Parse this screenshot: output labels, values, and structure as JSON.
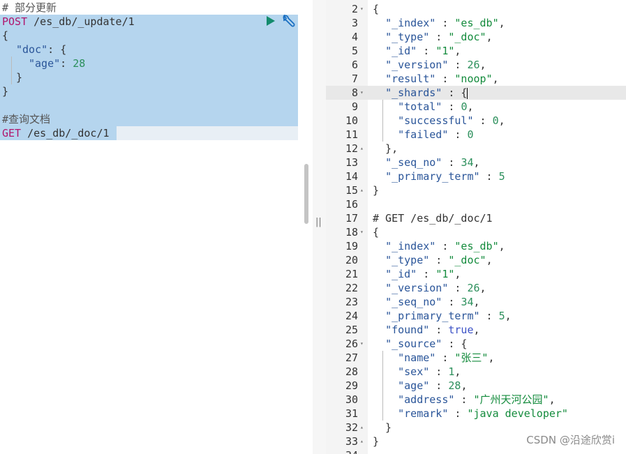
{
  "left_editor": {
    "lines": [
      {
        "text": "# 部分更新",
        "kind": "comment"
      },
      {
        "method": "POST",
        "path": "/es_db/_update/1"
      },
      {
        "text": "{"
      },
      {
        "key": "\"doc\"",
        "rest": ": {"
      },
      {
        "key": "\"age\"",
        "sep": ": ",
        "value": "28"
      },
      {
        "text": "}"
      },
      {
        "text": "}"
      },
      {
        "text": ""
      },
      {
        "text": "#查询文档",
        "kind": "comment"
      },
      {
        "method": "GET",
        "path": "/es_db/_doc/1"
      }
    ],
    "run_icon": "play-icon",
    "settings_icon": "wrench-icon"
  },
  "right_output": {
    "lines": [
      {
        "n": "2",
        "fold": "▾",
        "code": "{"
      },
      {
        "n": "3",
        "code": "  \"_index\" : \"es_db\","
      },
      {
        "n": "4",
        "code": "  \"_type\" : \"_doc\","
      },
      {
        "n": "5",
        "code": "  \"_id\" : \"1\","
      },
      {
        "n": "6",
        "code": "  \"_version\" : 26,"
      },
      {
        "n": "7",
        "code": "  \"result\" : \"noop\","
      },
      {
        "n": "8",
        "fold": "▾",
        "code": "  \"_shards\" : {",
        "active": true
      },
      {
        "n": "9",
        "code": "    \"total\" : 0,"
      },
      {
        "n": "10",
        "code": "    \"successful\" : 0,"
      },
      {
        "n": "11",
        "code": "    \"failed\" : 0"
      },
      {
        "n": "12",
        "fold": "▴",
        "code": "  },"
      },
      {
        "n": "13",
        "code": "  \"_seq_no\" : 34,"
      },
      {
        "n": "14",
        "code": "  \"_primary_term\" : 5"
      },
      {
        "n": "15",
        "fold": "▴",
        "code": "}"
      },
      {
        "n": "16",
        "code": ""
      },
      {
        "n": "17",
        "code": "# GET /es_db/_doc/1"
      },
      {
        "n": "18",
        "fold": "▾",
        "code": "{"
      },
      {
        "n": "19",
        "code": "  \"_index\" : \"es_db\","
      },
      {
        "n": "20",
        "code": "  \"_type\" : \"_doc\","
      },
      {
        "n": "21",
        "code": "  \"_id\" : \"1\","
      },
      {
        "n": "22",
        "code": "  \"_version\" : 26,"
      },
      {
        "n": "23",
        "code": "  \"_seq_no\" : 34,"
      },
      {
        "n": "24",
        "code": "  \"_primary_term\" : 5,"
      },
      {
        "n": "25",
        "code": "  \"found\" : true,"
      },
      {
        "n": "26",
        "fold": "▾",
        "code": "  \"_source\" : {"
      },
      {
        "n": "27",
        "code": "    \"name\" : \"张三\","
      },
      {
        "n": "28",
        "code": "    \"sex\" : 1,"
      },
      {
        "n": "29",
        "code": "    \"age\" : 28,"
      },
      {
        "n": "30",
        "code": "    \"address\" : \"广州天河公园\","
      },
      {
        "n": "31",
        "code": "    \"remark\" : \"java developer\""
      },
      {
        "n": "32",
        "fold": "▴",
        "code": "  }"
      },
      {
        "n": "33",
        "fold": "▴",
        "code": "}"
      },
      {
        "n": "34",
        "code": ""
      }
    ]
  },
  "watermark": "CSDN @沿途欣赏i",
  "colors": {
    "selection": "#b5d5ee",
    "method": "#b0166d",
    "string": "#138b3c",
    "key": "#2a5599"
  }
}
